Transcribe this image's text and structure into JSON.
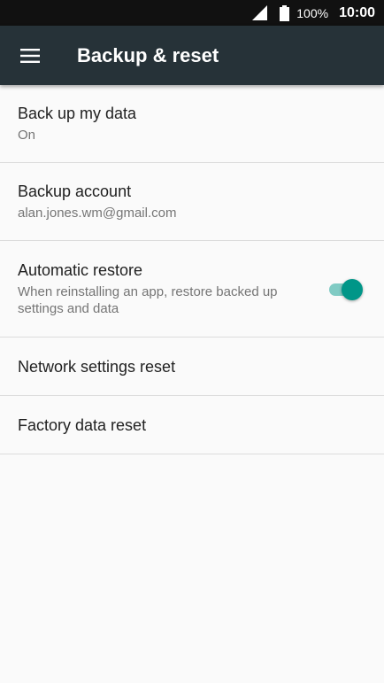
{
  "status_bar": {
    "battery_percent": "100%",
    "time": "10:00",
    "icons": [
      "cell-signal-icon",
      "battery-icon"
    ]
  },
  "toolbar": {
    "title": "Backup & reset",
    "menu_icon": "hamburger-menu-icon",
    "color": "#263238"
  },
  "settings": [
    {
      "title": "Back up my data",
      "summary": "On"
    },
    {
      "title": "Backup account",
      "summary": "alan.jones.wm@gmail.com"
    },
    {
      "title": "Automatic restore",
      "summary": "When reinstalling an app, restore backed up settings and data",
      "switch_on": true
    },
    {
      "title": "Network settings reset"
    },
    {
      "title": "Factory data reset"
    }
  ],
  "colors": {
    "accent": "#009688",
    "accent_track": "#80cbc4",
    "background": "#fafafa"
  }
}
